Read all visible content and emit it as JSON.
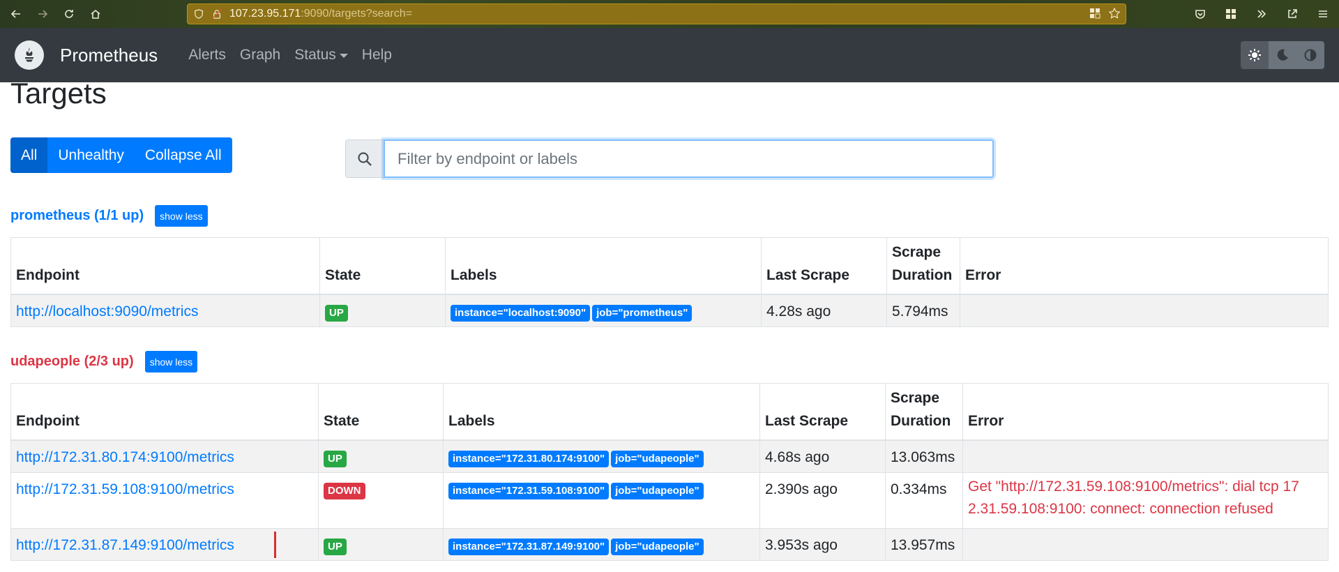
{
  "browser": {
    "url_host": "107.23.95.171",
    "url_rest": ":9090/targets?search="
  },
  "navbar": {
    "brand": "Prometheus",
    "links": [
      "Alerts",
      "Graph",
      "Status",
      "Help"
    ]
  },
  "page": {
    "title": "Targets"
  },
  "filters": {
    "all": "All",
    "unhealthy": "Unhealthy",
    "collapse": "Collapse All",
    "search_placeholder": "Filter by endpoint or labels"
  },
  "columns": [
    "Endpoint",
    "State",
    "Labels",
    "Last Scrape",
    "Scrape Duration",
    "Error"
  ],
  "column_labels": {
    "scrape_duration_line1": "Scrape",
    "scrape_duration_line2": "Duration"
  },
  "jobs": [
    {
      "title": "prometheus (1/1 up)",
      "toggle": "show less",
      "rows": [
        {
          "endpoint": "http://localhost:9090/metrics",
          "state": "UP",
          "labels": [
            "instance=\"localhost:9090\"",
            "job=\"prometheus\""
          ],
          "last_scrape": "4.28s ago",
          "duration": "5.794ms",
          "error": ""
        }
      ]
    },
    {
      "title": "udapeople (2/3 up)",
      "toggle": "show less",
      "rows": [
        {
          "endpoint": "http://172.31.80.174:9100/metrics",
          "state": "UP",
          "labels": [
            "instance=\"172.31.80.174:9100\"",
            "job=\"udapeople\""
          ],
          "last_scrape": "4.68s ago",
          "duration": "13.063ms",
          "error": ""
        },
        {
          "endpoint": "http://172.31.59.108:9100/metrics",
          "state": "DOWN",
          "labels": [
            "instance=\"172.31.59.108:9100\"",
            "job=\"udapeople\""
          ],
          "last_scrape": "2.390s ago",
          "duration": "0.334ms",
          "error_line1": "Get \"http://172.31.59.108:9100/metrics\": dial tcp 17",
          "error_line2": "2.31.59.108:9100: connect: connection refused"
        },
        {
          "endpoint": "http://172.31.87.149:9100/metrics",
          "state": "UP",
          "labels": [
            "instance=\"172.31.87.149:9100\"",
            "job=\"udapeople\""
          ],
          "last_scrape": "3.953s ago",
          "duration": "13.957ms",
          "error": ""
        }
      ]
    }
  ],
  "colors": {
    "navbar": "#343a40",
    "primary": "#007bff",
    "success": "#28a745",
    "danger": "#dc3545"
  },
  "icons": [
    "back-icon",
    "forward-icon",
    "reload-icon",
    "home-icon",
    "shield-icon",
    "lock-icon",
    "grid-icon",
    "star-icon",
    "pocket-icon",
    "extensions-icon",
    "chevrons-icon",
    "share-icon",
    "menu-icon",
    "prometheus-logo-icon",
    "sun-icon",
    "moon-icon",
    "contrast-icon",
    "search-icon"
  ]
}
